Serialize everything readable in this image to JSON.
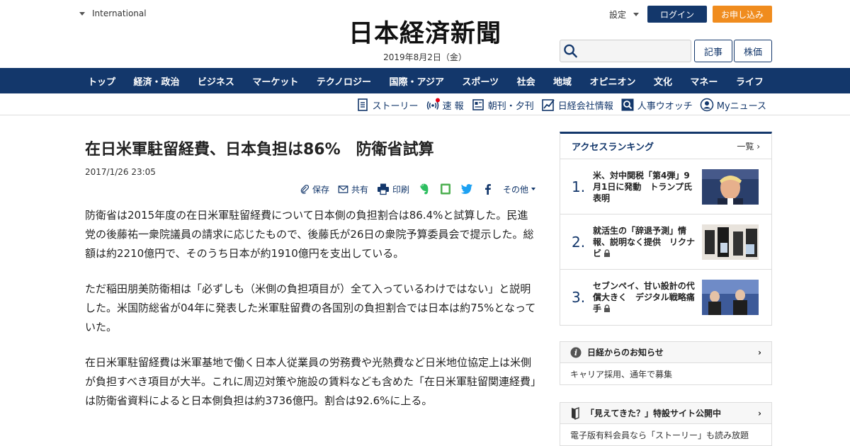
{
  "header": {
    "international": "International",
    "logo": "日本経済新聞",
    "date": "2019年8月2日（金）",
    "settings": "設定",
    "login": "ログイン",
    "apply": "お申し込み",
    "search_placeholder": "",
    "article_btn": "記事",
    "stock_btn": "株価"
  },
  "nav": {
    "items": [
      "トップ",
      "経済・政治",
      "ビジネス",
      "マーケット",
      "テクノロジー",
      "国際・アジア",
      "スポーツ",
      "社会",
      "地域",
      "オピニオン",
      "文化",
      "マネー",
      "ライフ"
    ]
  },
  "subnav": {
    "items": [
      "ストーリー",
      "速 報",
      "朝刊・夕刊",
      "日経会社情報",
      "人事ウオッチ",
      "Myニュース"
    ]
  },
  "article": {
    "headline": "在日米軍駐留経費、日本負担は86%　防衛省試算",
    "date": "2017/1/26 23:05",
    "share": {
      "save": "保存",
      "share": "共有",
      "print": "印刷",
      "other": "その他"
    },
    "paragraphs": [
      "防衛省は2015年度の在日米軍駐留経費について日本側の負担割合は86.4%と試算した。民進党の後藤祐一衆院議員の請求に応じたもので、後藤氏が26日の衆院予算委員会で提示した。総額は約2210億円で、そのうち日本が約1910億円を支出している。",
      "ただ稲田朋美防衛相は「必ずしも（米側の負担項目が）全て入っているわけではない」と説明した。米国防総省が04年に発表した米軍駐留費の各国別の負担割合では日本は約75%となっていた。",
      "在日米軍駐留経費は米軍基地で働く日本人従業員の労務費や光熱費など日米地位協定上は米側が負担すべき項目が大半。これに周辺対策や施設の賃料なども含めた「在日米軍駐留関連経費」は防衛省資料によると日本側負担は約3736億円。割合は92.6%に上る。"
    ]
  },
  "ranking": {
    "title": "アクセスランキング",
    "more": "一覧",
    "items": [
      {
        "num": "1.",
        "text": "米、対中関税「第4弾」9月1日に発動　トランプ氏表明"
      },
      {
        "num": "2.",
        "text": "就活生の「辞退予測」情報、説明なく提供　リクナビ"
      },
      {
        "num": "3.",
        "text": "セブンペイ、甘い設計の代償大きく　デジタル戦略痛手"
      }
    ]
  },
  "notices": [
    {
      "title": "日経からのお知らせ",
      "body": "キャリア採用、通年で募集"
    },
    {
      "title": "「見えてきた？」特設サイト公開中",
      "body": "電子版有料会員なら「ストーリー」も読み放題"
    }
  ],
  "colors": {
    "brand": "#13376b",
    "accent": "#f08c1e"
  }
}
